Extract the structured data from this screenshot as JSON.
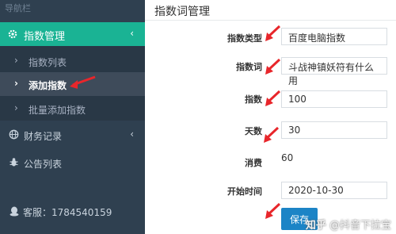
{
  "sidebar": {
    "title": "导航栏",
    "active_menu": {
      "label": "指数管理",
      "chevron": "‹"
    },
    "subitems": [
      {
        "label": "指数列表"
      },
      {
        "label": "添加指数"
      },
      {
        "label": "批量添加指数"
      }
    ],
    "menus": [
      {
        "label": "财务记录",
        "chevron": "‹"
      },
      {
        "label": "公告列表"
      }
    ],
    "service": "客服：1784540159"
  },
  "main": {
    "title": "指数词管理",
    "fields": {
      "type_label": "指数类型",
      "type_value": "百度电脑指数",
      "word_label": "指数词",
      "word_value": "斗战神镇妖符有什么用",
      "index_label": "指数",
      "index_value": "100",
      "days_label": "天数",
      "days_value": "30",
      "cost_label": "消费",
      "cost_value": "60",
      "start_label": "开始时间",
      "start_value": "2020-10-30"
    },
    "submit_label": "保存"
  },
  "watermark": {
    "brand": "知乎",
    "text": "@抖音下拉宝"
  },
  "colors": {
    "sidebar_bg": "#2f4050",
    "active_bg": "#1ab394",
    "annotation_red": "#e8262b",
    "button_blue": "#1c84c6"
  }
}
